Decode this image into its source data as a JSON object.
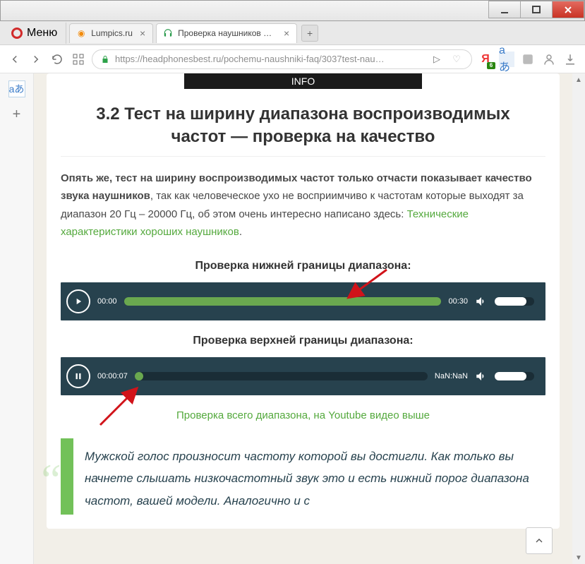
{
  "window": {
    "menu_label": "Меню"
  },
  "tabs": [
    {
      "label": "Lumpics.ru",
      "favico": "◯",
      "favico_color": "#f28b0c"
    },
    {
      "label": "Проверка наушников му…",
      "favico": "🎧",
      "favico_color": "#2a9b4d"
    }
  ],
  "toolbar": {
    "url": "https://headphonesbest.ru/pochemu-naushniki-faq/3037test-nau…",
    "yandex_badge": "6"
  },
  "sidebar": {
    "translate_label": "aあ"
  },
  "page": {
    "info_bar": "INFO",
    "heading": "3.2 Тест на ширину диапазона воспроизводимых частот — проверка на качество",
    "para_bold": "Опять же, тест на ширину воспроизводимых частот только отчасти показывает качество звука наушников",
    "para_rest": ", так как человеческое ухо не восприимчиво к частотам которые выходят за диапазон 20 Гц – 20000 Гц, об этом очень интересно написано здесь: ",
    "para_link": "Технические характеристики хороших наушников",
    "para_tail": ".",
    "label_low": "Проверка нижней границы диапазона:",
    "label_high": "Проверка верхней границы диапазона:",
    "player1": {
      "cur": "00:00",
      "dur": "00:30",
      "fill": "100%"
    },
    "player2": {
      "cur": "00:00:07",
      "dur": "NaN:NaN",
      "fill": "3%"
    },
    "link_full": "Проверка всего диапазона, на Youtube видео выше",
    "quote": "Мужской голос произносит частоту которой вы достигли. Как только вы начнете слышать низкочастотный звук это и есть нижний порог диапазона частот, вашей модели. Аналогично и с"
  }
}
